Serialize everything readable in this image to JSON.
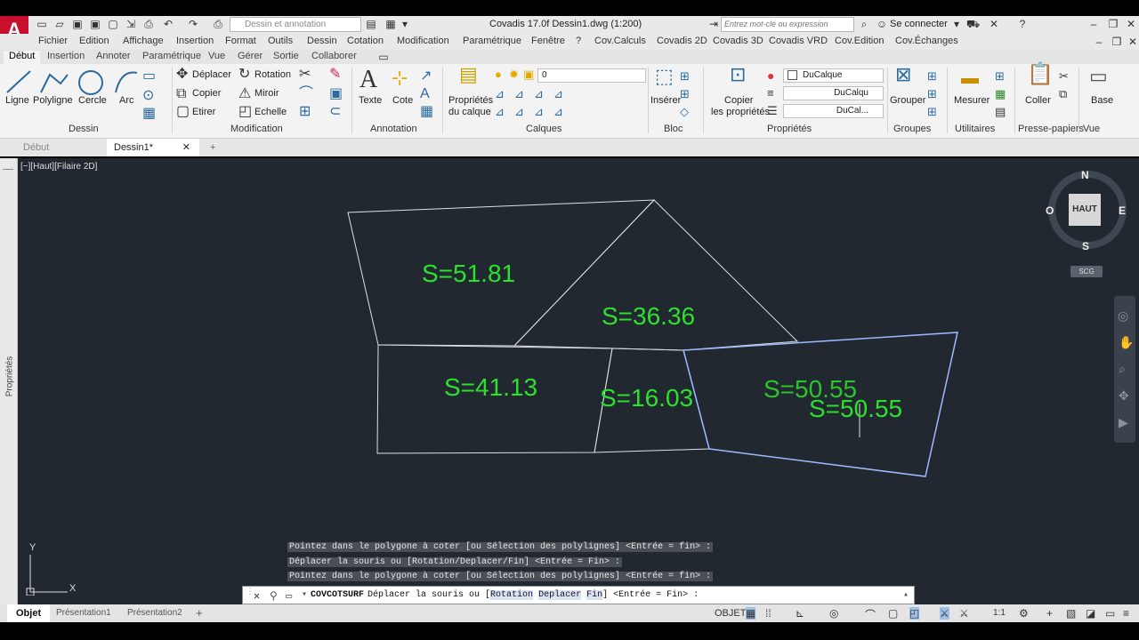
{
  "app": {
    "logo_letter": "A",
    "title": "Covadis 17.0f    Dessin1.dwg (1:200)",
    "workspace": "Dessin et annotation",
    "search_placeholder": "Entrez mot-clé ou expression",
    "signin": "Se connecter"
  },
  "menu": [
    "Fichier",
    "Edition",
    "Affichage",
    "Insertion",
    "Format",
    "Outils",
    "Dessin",
    "Cotation",
    "Modification",
    "Paramétrique",
    "Fenêtre",
    "?",
    "Cov.Calculs",
    "Covadis 2D",
    "Covadis 3D",
    "Covadis VRD",
    "Cov.Edition",
    "Cov.Échanges"
  ],
  "ribbon_tabs": [
    "Début",
    "Insertion",
    "Annoter",
    "Paramétrique",
    "Vue",
    "Gérer",
    "Sortie",
    "Collaborer"
  ],
  "ribbon": {
    "dessin": {
      "label": "Dessin",
      "ligne": "Ligne",
      "polyligne": "Polyligne",
      "cercle": "Cercle",
      "arc": "Arc"
    },
    "modification": {
      "label": "Modification",
      "deplacer": "Déplacer",
      "rotation": "Rotation",
      "copier": "Copier",
      "miroir": "Miroir",
      "etirer": "Etirer",
      "echelle": "Echelle"
    },
    "annotation": {
      "label": "Annotation",
      "texte": "Texte",
      "cote": "Cote"
    },
    "calques": {
      "label": "Calques",
      "proprietes_line1": "Propriétés",
      "proprietes_line2": "du calque",
      "layer_value": "0"
    },
    "bloc": {
      "label": "Bloc",
      "inserer": "Insérer"
    },
    "proprietes": {
      "label": "Propriétés",
      "copier_line1": "Copier",
      "copier_line2": "les propriétés",
      "color": "DuCalque",
      "linetype": "DuCalqu",
      "lineweight": "DuCal..."
    },
    "groupes": {
      "label": "Groupes",
      "grouper": "Grouper"
    },
    "utilitaires": {
      "label": "Utilitaires",
      "mesurer": "Mesurer"
    },
    "presse": {
      "label": "Presse-papiers",
      "coller": "Coller"
    },
    "vue": {
      "label": "Vue",
      "base": "Base"
    }
  },
  "doc_tabs": [
    "Début",
    "Dessin1*"
  ],
  "viewport": {
    "label": "[−][Haut][Filaire 2D]",
    "viewcube": {
      "n": "N",
      "s": "S",
      "e": "E",
      "w": "O",
      "top": "HAUT",
      "scg": "SCG"
    },
    "properties_palette": "Propriétés",
    "ucs_x": "X",
    "ucs_y": "Y"
  },
  "areas": [
    "S=51.81",
    "S=36.36",
    "S=41.13",
    "S=16.03",
    "S=50.55",
    "S=50.55"
  ],
  "command_history": [
    "Pointez dans le polygone à coter [ou Sélection des polylignes] <Entrée = fin> :",
    "Déplacer la souris ou [Rotation/Deplacer/Fin] <Entrée = Fin> :",
    "Pointez dans le polygone à coter [ou Sélection des polylignes] <Entrée = fin> :"
  ],
  "command_line": {
    "command": "COVCOTSURF",
    "prompt_start": "Déplacer la souris ou [",
    "opt1": "Rotation",
    "opt2": "Deplacer",
    "opt3": "Fin",
    "prompt_end": "] <Entrée = Fin> :"
  },
  "status": {
    "layout_tabs": [
      "Objet",
      "Présentation1",
      "Présentation2"
    ],
    "mode": "OBJET",
    "scale": "1:1"
  },
  "colors": {
    "canvas": "#212830",
    "geometry": "#e0e0e0",
    "selected": "#9fb9ff",
    "area_text": "#2de02d",
    "accent_red": "#c8102e"
  }
}
